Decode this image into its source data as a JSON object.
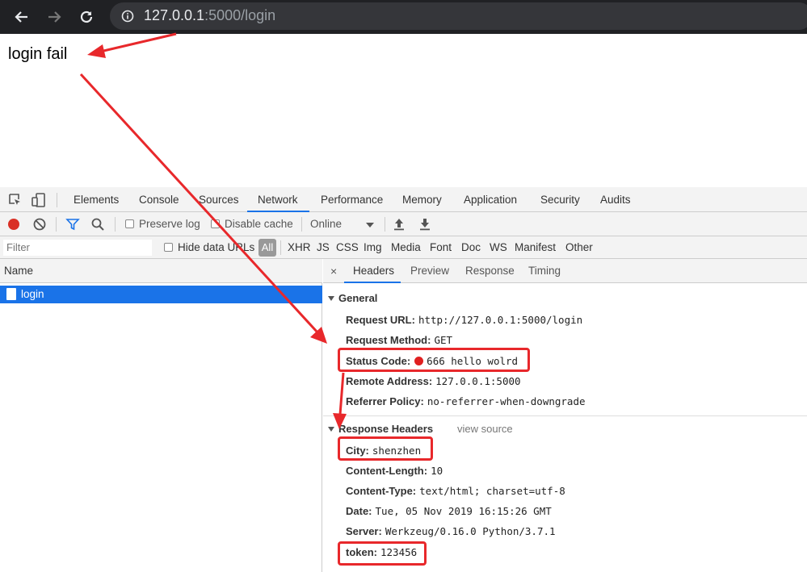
{
  "browser": {
    "url_host": "127.0.0.1",
    "url_rest": ":5000/login"
  },
  "page": {
    "body_text": "login fail"
  },
  "devtools": {
    "tabs": [
      "Elements",
      "Console",
      "Sources",
      "Network",
      "Performance",
      "Memory",
      "Application",
      "Security",
      "Audits"
    ],
    "active_tab": "Network",
    "toolbar": {
      "preserve_log": "Preserve log",
      "disable_cache": "Disable cache",
      "throttle": "Online"
    },
    "filter": {
      "placeholder": "Filter",
      "hide_data_urls": "Hide data URLs",
      "all": "All",
      "types": [
        "XHR",
        "JS",
        "CSS",
        "Img",
        "Media",
        "Font",
        "Doc",
        "WS",
        "Manifest",
        "Other"
      ]
    },
    "name_header": "Name",
    "request_name": "login",
    "detail_tabs": [
      "Headers",
      "Preview",
      "Response",
      "Timing"
    ],
    "close_symbol": "×",
    "general": {
      "title": "General",
      "request_url_label": "Request URL:",
      "request_url": "http://127.0.0.1:5000/login",
      "request_method_label": "Request Method:",
      "request_method": "GET",
      "status_code_label": "Status Code:",
      "status_code": "666 hello wolrd",
      "remote_address_label": "Remote Address:",
      "remote_address": "127.0.0.1:5000",
      "referrer_policy_label": "Referrer Policy:",
      "referrer_policy": "no-referrer-when-downgrade"
    },
    "response_headers": {
      "title": "Response Headers",
      "view_source": "view source",
      "city_label": "City:",
      "city": "shenzhen",
      "content_length_label": "Content-Length:",
      "content_length": "10",
      "content_type_label": "Content-Type:",
      "content_type": "text/html; charset=utf-8",
      "date_label": "Date:",
      "date": "Tue, 05 Nov 2019 16:15:26 GMT",
      "server_label": "Server:",
      "server": "Werkzeug/0.16.0 Python/3.7.1",
      "token_label": "token:",
      "token": "123456"
    }
  },
  "colors": {
    "annotation_red": "#e8282b",
    "selection_blue": "#1a73e8",
    "status_dot": "#e02020"
  }
}
